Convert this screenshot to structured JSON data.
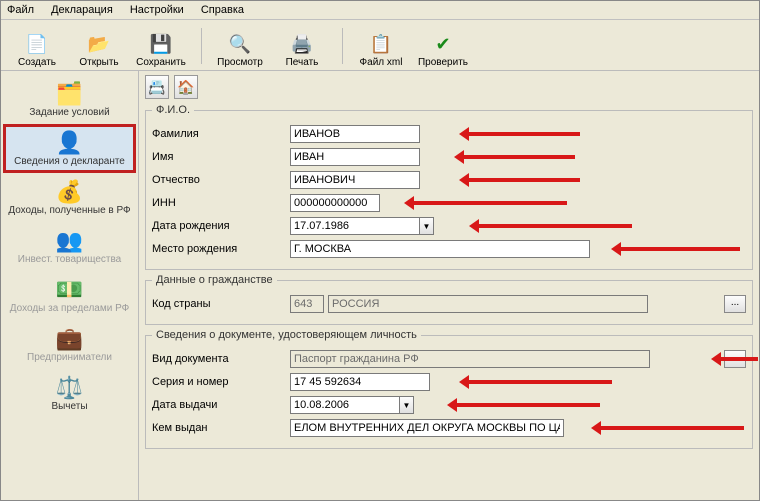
{
  "menu": {
    "file": "Файл",
    "decl": "Декларация",
    "settings": "Настройки",
    "help": "Справка"
  },
  "toolbar": {
    "create": "Создать",
    "open": "Открыть",
    "save": "Сохранить",
    "preview": "Просмотр",
    "print": "Печать",
    "xml": "Файл xml",
    "check": "Проверить"
  },
  "sidebar": {
    "conditions": "Задание условий",
    "declarant": "Сведения о декларанте",
    "income_rf": "Доходы, полученные в РФ",
    "invest": "Инвест. товарищества",
    "income_abroad": "Доходы за пределами РФ",
    "entrepreneur": "Предприниматели",
    "deductions": "Вычеты"
  },
  "groups": {
    "fio": "Ф.И.О.",
    "citizenship": "Данные о гражданстве",
    "document": "Сведения о документе, удостоверяющем личность"
  },
  "labels": {
    "surname": "Фамилия",
    "name": "Имя",
    "patronymic": "Отчество",
    "inn": "ИНН",
    "birthdate": "Дата рождения",
    "birthplace": "Место рождения",
    "country_code": "Код страны",
    "doc_type": "Вид документа",
    "series_num": "Серия и номер",
    "issue_date": "Дата выдачи",
    "issued_by": "Кем выдан"
  },
  "values": {
    "surname": "ИВАНОВ",
    "name": "ИВАН",
    "patronymic": "ИВАНОВИЧ",
    "inn": "000000000000",
    "birthdate": "17.07.1986",
    "birthplace": "Г. МОСКВА",
    "country_code": "643",
    "country_name": "РОССИЯ",
    "doc_type": "Паспорт гражданина РФ",
    "series_num": "17 45 592634",
    "issue_date": "10.08.2006",
    "issued_by": "ЕЛОМ ВНУТРЕННИХ ДЕЛ ОКРУГА МОСКВЫ ПО ЦАО"
  }
}
